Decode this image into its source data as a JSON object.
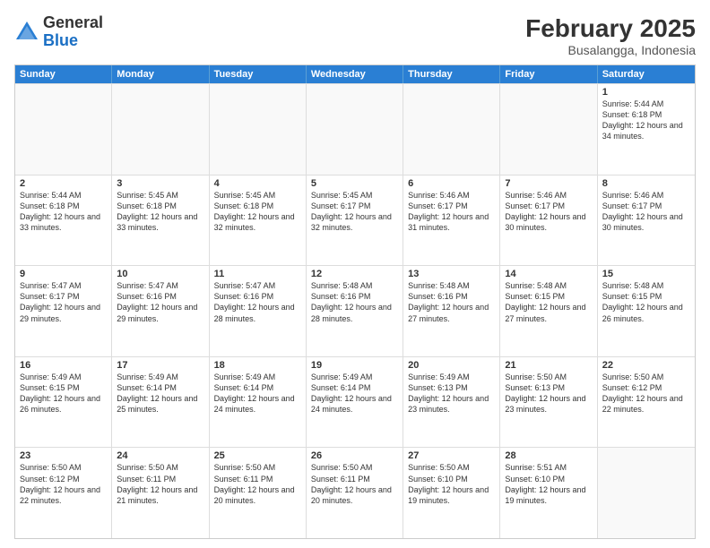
{
  "header": {
    "logo_general": "General",
    "logo_blue": "Blue",
    "month_year": "February 2025",
    "location": "Busalangga, Indonesia"
  },
  "days_of_week": [
    "Sunday",
    "Monday",
    "Tuesday",
    "Wednesday",
    "Thursday",
    "Friday",
    "Saturday"
  ],
  "weeks": [
    [
      {
        "day": "",
        "empty": true
      },
      {
        "day": "",
        "empty": true
      },
      {
        "day": "",
        "empty": true
      },
      {
        "day": "",
        "empty": true
      },
      {
        "day": "",
        "empty": true
      },
      {
        "day": "",
        "empty": true
      },
      {
        "day": "1",
        "sunrise": "Sunrise: 5:44 AM",
        "sunset": "Sunset: 6:18 PM",
        "daylight": "Daylight: 12 hours and 34 minutes."
      }
    ],
    [
      {
        "day": "2",
        "sunrise": "Sunrise: 5:44 AM",
        "sunset": "Sunset: 6:18 PM",
        "daylight": "Daylight: 12 hours and 33 minutes."
      },
      {
        "day": "3",
        "sunrise": "Sunrise: 5:45 AM",
        "sunset": "Sunset: 6:18 PM",
        "daylight": "Daylight: 12 hours and 33 minutes."
      },
      {
        "day": "4",
        "sunrise": "Sunrise: 5:45 AM",
        "sunset": "Sunset: 6:18 PM",
        "daylight": "Daylight: 12 hours and 32 minutes."
      },
      {
        "day": "5",
        "sunrise": "Sunrise: 5:45 AM",
        "sunset": "Sunset: 6:17 PM",
        "daylight": "Daylight: 12 hours and 32 minutes."
      },
      {
        "day": "6",
        "sunrise": "Sunrise: 5:46 AM",
        "sunset": "Sunset: 6:17 PM",
        "daylight": "Daylight: 12 hours and 31 minutes."
      },
      {
        "day": "7",
        "sunrise": "Sunrise: 5:46 AM",
        "sunset": "Sunset: 6:17 PM",
        "daylight": "Daylight: 12 hours and 30 minutes."
      },
      {
        "day": "8",
        "sunrise": "Sunrise: 5:46 AM",
        "sunset": "Sunset: 6:17 PM",
        "daylight": "Daylight: 12 hours and 30 minutes."
      }
    ],
    [
      {
        "day": "9",
        "sunrise": "Sunrise: 5:47 AM",
        "sunset": "Sunset: 6:17 PM",
        "daylight": "Daylight: 12 hours and 29 minutes."
      },
      {
        "day": "10",
        "sunrise": "Sunrise: 5:47 AM",
        "sunset": "Sunset: 6:16 PM",
        "daylight": "Daylight: 12 hours and 29 minutes."
      },
      {
        "day": "11",
        "sunrise": "Sunrise: 5:47 AM",
        "sunset": "Sunset: 6:16 PM",
        "daylight": "Daylight: 12 hours and 28 minutes."
      },
      {
        "day": "12",
        "sunrise": "Sunrise: 5:48 AM",
        "sunset": "Sunset: 6:16 PM",
        "daylight": "Daylight: 12 hours and 28 minutes."
      },
      {
        "day": "13",
        "sunrise": "Sunrise: 5:48 AM",
        "sunset": "Sunset: 6:16 PM",
        "daylight": "Daylight: 12 hours and 27 minutes."
      },
      {
        "day": "14",
        "sunrise": "Sunrise: 5:48 AM",
        "sunset": "Sunset: 6:15 PM",
        "daylight": "Daylight: 12 hours and 27 minutes."
      },
      {
        "day": "15",
        "sunrise": "Sunrise: 5:48 AM",
        "sunset": "Sunset: 6:15 PM",
        "daylight": "Daylight: 12 hours and 26 minutes."
      }
    ],
    [
      {
        "day": "16",
        "sunrise": "Sunrise: 5:49 AM",
        "sunset": "Sunset: 6:15 PM",
        "daylight": "Daylight: 12 hours and 26 minutes."
      },
      {
        "day": "17",
        "sunrise": "Sunrise: 5:49 AM",
        "sunset": "Sunset: 6:14 PM",
        "daylight": "Daylight: 12 hours and 25 minutes."
      },
      {
        "day": "18",
        "sunrise": "Sunrise: 5:49 AM",
        "sunset": "Sunset: 6:14 PM",
        "daylight": "Daylight: 12 hours and 24 minutes."
      },
      {
        "day": "19",
        "sunrise": "Sunrise: 5:49 AM",
        "sunset": "Sunset: 6:14 PM",
        "daylight": "Daylight: 12 hours and 24 minutes."
      },
      {
        "day": "20",
        "sunrise": "Sunrise: 5:49 AM",
        "sunset": "Sunset: 6:13 PM",
        "daylight": "Daylight: 12 hours and 23 minutes."
      },
      {
        "day": "21",
        "sunrise": "Sunrise: 5:50 AM",
        "sunset": "Sunset: 6:13 PM",
        "daylight": "Daylight: 12 hours and 23 minutes."
      },
      {
        "day": "22",
        "sunrise": "Sunrise: 5:50 AM",
        "sunset": "Sunset: 6:12 PM",
        "daylight": "Daylight: 12 hours and 22 minutes."
      }
    ],
    [
      {
        "day": "23",
        "sunrise": "Sunrise: 5:50 AM",
        "sunset": "Sunset: 6:12 PM",
        "daylight": "Daylight: 12 hours and 22 minutes."
      },
      {
        "day": "24",
        "sunrise": "Sunrise: 5:50 AM",
        "sunset": "Sunset: 6:11 PM",
        "daylight": "Daylight: 12 hours and 21 minutes."
      },
      {
        "day": "25",
        "sunrise": "Sunrise: 5:50 AM",
        "sunset": "Sunset: 6:11 PM",
        "daylight": "Daylight: 12 hours and 20 minutes."
      },
      {
        "day": "26",
        "sunrise": "Sunrise: 5:50 AM",
        "sunset": "Sunset: 6:11 PM",
        "daylight": "Daylight: 12 hours and 20 minutes."
      },
      {
        "day": "27",
        "sunrise": "Sunrise: 5:50 AM",
        "sunset": "Sunset: 6:10 PM",
        "daylight": "Daylight: 12 hours and 19 minutes."
      },
      {
        "day": "28",
        "sunrise": "Sunrise: 5:51 AM",
        "sunset": "Sunset: 6:10 PM",
        "daylight": "Daylight: 12 hours and 19 minutes."
      },
      {
        "day": "",
        "empty": true
      }
    ]
  ]
}
